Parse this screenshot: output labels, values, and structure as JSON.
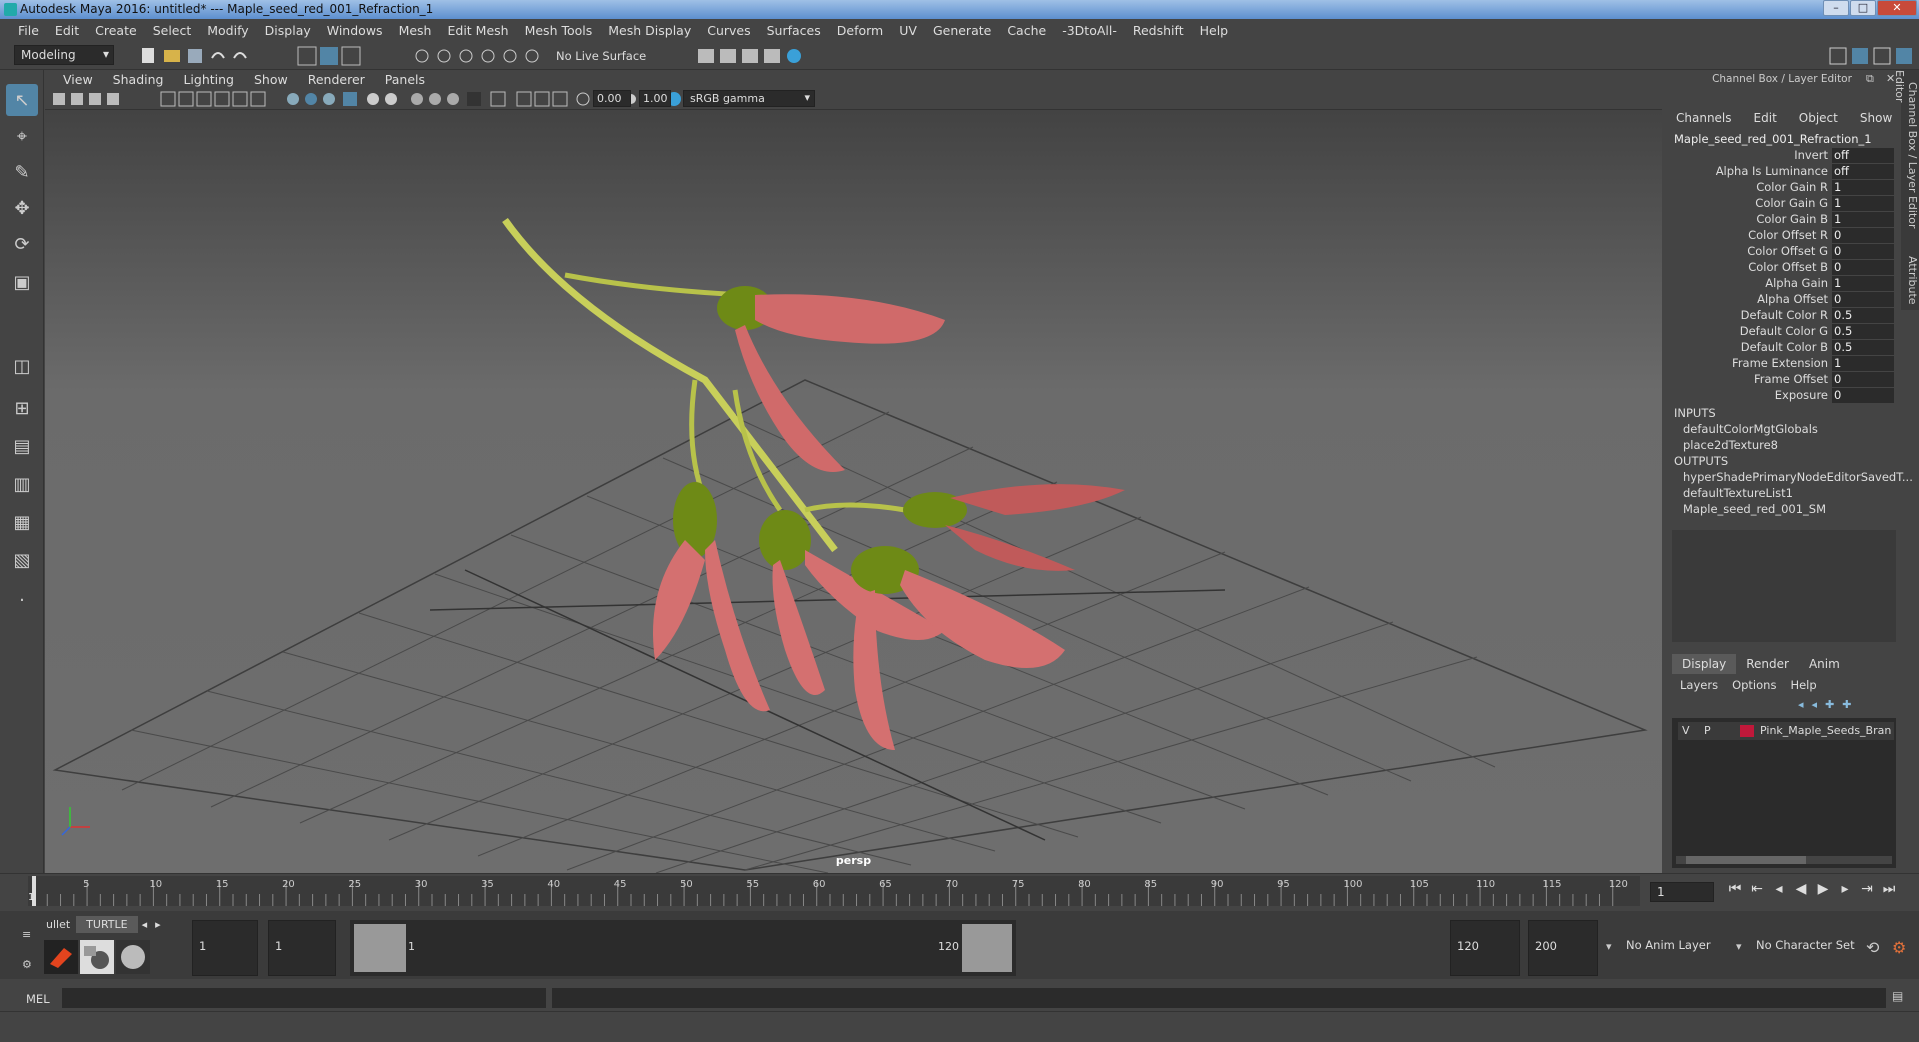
{
  "window": {
    "title": "Autodesk Maya 2016: untitled*   ---   Maple_seed_red_001_Refraction_1",
    "minimize": "–",
    "maximize": "□",
    "close": "✕"
  },
  "menubar": [
    "File",
    "Edit",
    "Create",
    "Select",
    "Modify",
    "Display",
    "Windows",
    "Mesh",
    "Edit Mesh",
    "Mesh Tools",
    "Mesh Display",
    "Curves",
    "Surfaces",
    "Deform",
    "UV",
    "Generate",
    "Cache",
    "-3DtoAll-",
    "Redshift",
    "Help"
  ],
  "statusline": {
    "mode": "Modeling",
    "live_surface": "No Live Surface"
  },
  "viewport": {
    "menu": [
      "View",
      "Shading",
      "Lighting",
      "Show",
      "Renderer",
      "Panels"
    ],
    "exposure": "0.00",
    "gamma": "1.00",
    "color_space": "sRGB gamma",
    "camera_label": "persp"
  },
  "channelbox": {
    "title": "Channel Box / Layer Editor",
    "menu": [
      "Channels",
      "Edit",
      "Object",
      "Show"
    ],
    "node_name": "Maple_seed_red_001_Refraction_1",
    "attributes": [
      {
        "label": "Invert",
        "value": "off"
      },
      {
        "label": "Alpha Is Luminance",
        "value": "off"
      },
      {
        "label": "Color Gain R",
        "value": "1"
      },
      {
        "label": "Color Gain G",
        "value": "1"
      },
      {
        "label": "Color Gain B",
        "value": "1"
      },
      {
        "label": "Color Offset R",
        "value": "0"
      },
      {
        "label": "Color Offset G",
        "value": "0"
      },
      {
        "label": "Color Offset B",
        "value": "0"
      },
      {
        "label": "Alpha Gain",
        "value": "1"
      },
      {
        "label": "Alpha Offset",
        "value": "0"
      },
      {
        "label": "Default Color R",
        "value": "0.5"
      },
      {
        "label": "Default Color G",
        "value": "0.5"
      },
      {
        "label": "Default Color B",
        "value": "0.5"
      },
      {
        "label": "Frame Extension",
        "value": "1"
      },
      {
        "label": "Frame Offset",
        "value": "0"
      },
      {
        "label": "Exposure",
        "value": "0"
      }
    ],
    "inputs_label": "INPUTS",
    "inputs": [
      "defaultColorMgtGlobals",
      "place2dTexture8"
    ],
    "outputs_label": "OUTPUTS",
    "outputs": [
      "hyperShadePrimaryNodeEditorSavedT...",
      "defaultTextureList1",
      "Maple_seed_red_001_SM"
    ]
  },
  "side_tabs": [
    "Channel Box / Layer Editor",
    "Attribute Editor"
  ],
  "layer_editor": {
    "tabs": [
      "Display",
      "Render",
      "Anim"
    ],
    "menu": [
      "Layers",
      "Options",
      "Help"
    ],
    "layer": {
      "v": "V",
      "p": "P",
      "name": "Pink_Maple_Seeds_Bran",
      "color": "#c0183a"
    }
  },
  "timeline": {
    "ticks": [
      "5",
      "10",
      "15",
      "20",
      "25",
      "30",
      "35",
      "40",
      "45",
      "50",
      "55",
      "60",
      "65",
      "70",
      "75",
      "80",
      "85",
      "90",
      "95",
      "100",
      "105",
      "110",
      "115",
      "120"
    ],
    "start_marker": "1",
    "current_frame": "1"
  },
  "range": {
    "shelf_tabs": [
      "ullet",
      "TURTLE"
    ],
    "start": "1",
    "playback_start": "1",
    "range_start_label": "1",
    "range_end_label": "120",
    "playback_end": "120",
    "end": "200",
    "anim_layer": "No Anim Layer",
    "character_set": "No Character Set"
  },
  "cmdline": {
    "label": "MEL"
  }
}
